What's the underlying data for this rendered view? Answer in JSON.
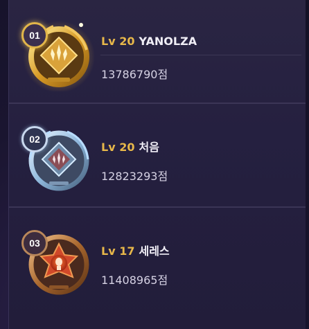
{
  "ranking": [
    {
      "rank": "01",
      "lv_prefix": "Lv 20",
      "name": "YANOLZA",
      "score": "13786790점",
      "tier": "gold",
      "emblem_icon": "gold-emblem-icon"
    },
    {
      "rank": "02",
      "lv_prefix": "Lv 20",
      "name": "처음",
      "score": "12823293점",
      "tier": "silver",
      "emblem_icon": "silver-emblem-icon"
    },
    {
      "rank": "03",
      "lv_prefix": "Lv 17",
      "name": "세레스",
      "score": "11408965점",
      "tier": "bronze",
      "emblem_icon": "bronze-emblem-icon"
    }
  ],
  "colors": {
    "background": "#1a1530",
    "panel": "#252040",
    "level_accent": "#e8b84a",
    "name_text": "#f0eef6",
    "score_text": "#d6d2e4",
    "gold": "#e2b64a",
    "silver": "#c8d8ee",
    "bronze": "#b9875a"
  }
}
